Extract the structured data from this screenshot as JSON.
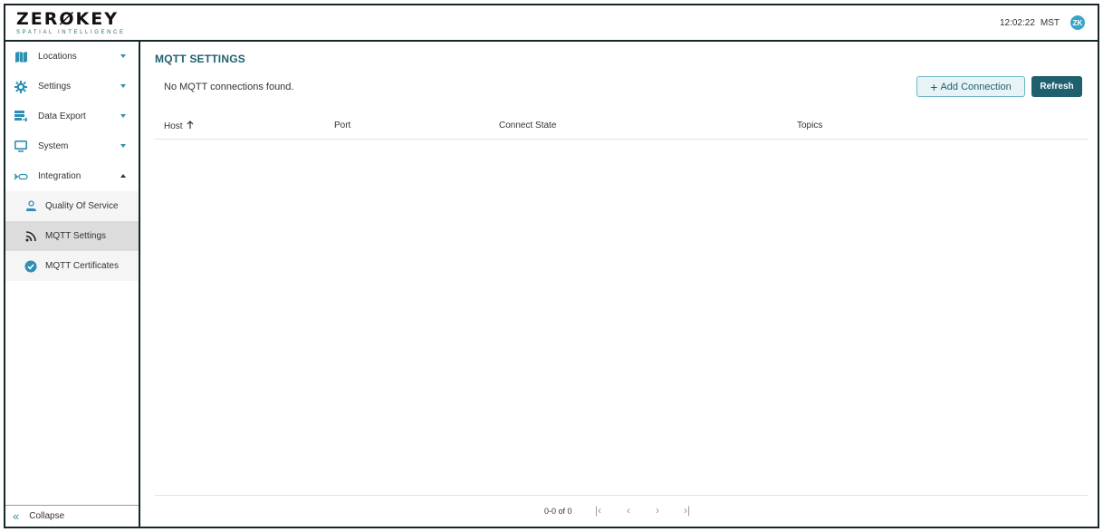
{
  "header": {
    "logo_text": "ZERØKEY",
    "logo_sub": "SPATIAL INTELLIGENCE",
    "time": "12:02:22",
    "timezone": "MST",
    "avatar_initials": "ZK"
  },
  "sidebar": {
    "items": [
      {
        "label": "Locations",
        "icon": "map-icon",
        "expanded": false
      },
      {
        "label": "Settings",
        "icon": "gear-icon",
        "expanded": false
      },
      {
        "label": "Data Export",
        "icon": "data-export-icon",
        "expanded": false
      },
      {
        "label": "System",
        "icon": "monitor-icon",
        "expanded": false
      },
      {
        "label": "Integration",
        "icon": "integration-icon",
        "expanded": true
      }
    ],
    "sub_items": [
      {
        "label": "Quality Of Service",
        "icon": "quality-of-service-icon",
        "active": false
      },
      {
        "label": "MQTT Settings",
        "icon": "rss-icon",
        "active": true
      },
      {
        "label": "MQTT Certificates",
        "icon": "verified-badge-icon",
        "active": false
      }
    ],
    "collapse_label": "Collapse"
  },
  "main": {
    "title": "MQTT SETTINGS",
    "empty_message": "No MQTT connections found.",
    "add_button": "Add Connection",
    "refresh_button": "Refresh",
    "columns": [
      "Host",
      "Port",
      "Connect State",
      "Topics"
    ],
    "sort_column": "Host",
    "sort_direction": "ascending"
  },
  "pagination": {
    "range_text": "0-0 of 0"
  },
  "colors": {
    "accent": "#1f5f6e",
    "icon_blue": "#2e8fb3",
    "frame": "#15282c"
  }
}
